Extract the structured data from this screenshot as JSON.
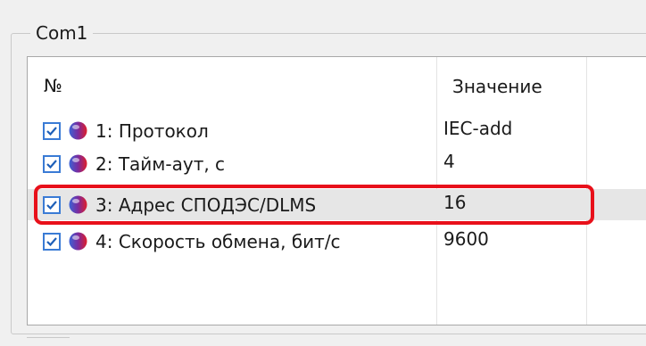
{
  "group": {
    "title": "Com1"
  },
  "list": {
    "columns": {
      "number": "№",
      "value": "Значение"
    },
    "rows": [
      {
        "label": "1: Протокол",
        "value": "IEC-add",
        "checked": true
      },
      {
        "label": "2: Тайм-аут, с",
        "value": "4",
        "checked": true
      },
      {
        "label": "3: Адрес СПОДЭС/DLMS",
        "value": "16",
        "checked": true,
        "selected": true
      },
      {
        "label": "4: Скорость обмена, бит/с",
        "value": "9600",
        "checked": true
      }
    ]
  },
  "colors": {
    "highlight": "#e8101a",
    "checkbox": "#3a7bd5",
    "selection": "#e6e6e6"
  },
  "icons": {
    "checkbox": "checkmark-icon",
    "row_status": "status-ball-icon"
  }
}
